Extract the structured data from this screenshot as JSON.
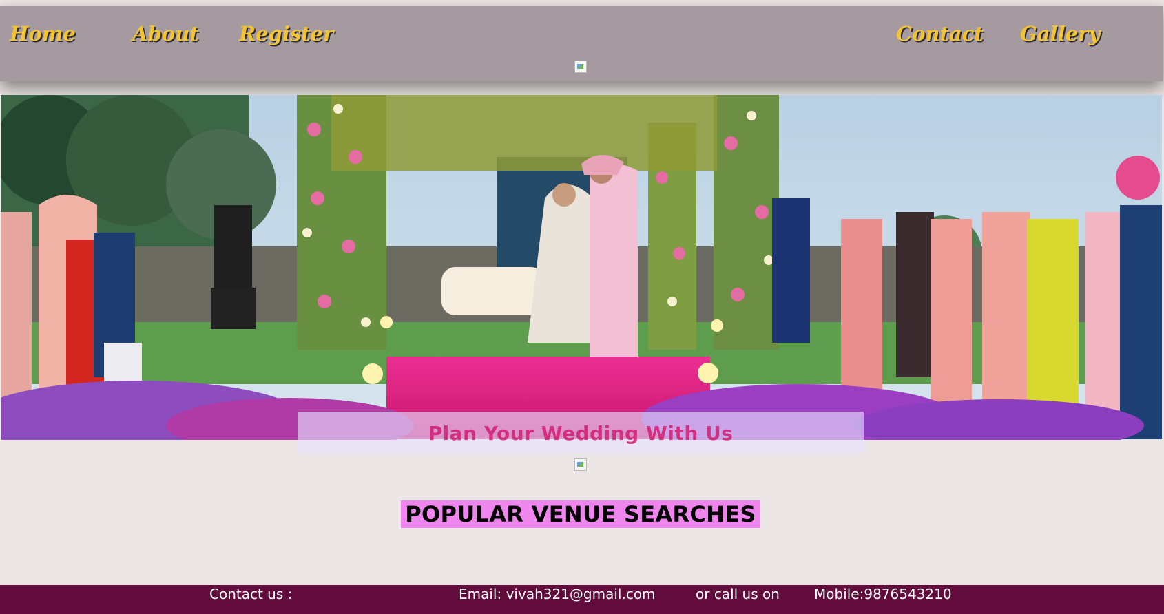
{
  "nav": {
    "home": "Home",
    "about": "About",
    "register": "Register",
    "contact": "Contact",
    "gallery": "Gallery"
  },
  "hero": {
    "tagline": "Plan Your Wedding With Us"
  },
  "main": {
    "section_title": "POPULAR VENUE SEARCHES"
  },
  "footer": {
    "label": "Contact us :",
    "email": "Email: vivah321@gmail.com",
    "call": "or call us on",
    "mobile": "Mobile:9876543210"
  },
  "colors": {
    "header_bg": "#a59aa0",
    "nav_text": "#f4c430",
    "page_bg": "#ece6e6",
    "section_highlight": "#ee86ee",
    "footer_bg": "#620c3e"
  }
}
